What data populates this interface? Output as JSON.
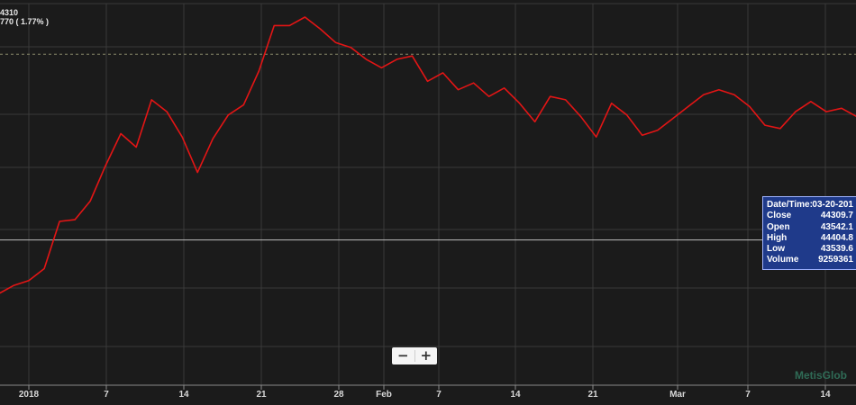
{
  "header": {
    "last_value": "4310",
    "change_text": "770 ( 1.77% )"
  },
  "tooltip": {
    "rows": [
      {
        "label": "Date/Time:",
        "value": "03-20-201"
      },
      {
        "label": "Close",
        "value": "44309.7"
      },
      {
        "label": "Open",
        "value": "43542.1"
      },
      {
        "label": "High",
        "value": "44404.8"
      },
      {
        "label": "Low",
        "value": "43539.6"
      },
      {
        "label": "Volume",
        "value": "9259361"
      }
    ]
  },
  "zoom": {
    "minus_label": "−",
    "plus_label": "+"
  },
  "watermark": "MetisGlob",
  "colors": {
    "background": "#1b1b1b",
    "series": "#e31515",
    "grid": "#3a3a3a",
    "tooltip_bg": "#1f3a8a"
  },
  "chart_data": {
    "type": "line",
    "x_tick_labels": [
      "2018",
      "7",
      "14",
      "21",
      "28",
      "Feb",
      "7",
      "14",
      "21",
      "Mar",
      "7",
      "14"
    ],
    "series": [
      {
        "values": [
          37200,
          37450,
          37600,
          37950,
          39350,
          39400,
          39950,
          41000,
          41950,
          41550,
          42950,
          42600,
          41850,
          40800,
          41800,
          42500,
          42800,
          43800,
          45150,
          45150,
          45400,
          45050,
          44650,
          44500,
          44150,
          43900,
          44150,
          44250,
          43500,
          43750,
          43250,
          43450,
          43050,
          43300,
          42850,
          42300,
          43050,
          42950,
          42450,
          41850,
          42850,
          42500,
          41900,
          42050,
          42400,
          42750,
          43100,
          43250,
          43100,
          42750,
          42200,
          42100,
          42600,
          42900,
          42600,
          42700,
          42450
        ]
      }
    ],
    "ylim": [
      34500,
      45800
    ],
    "reference_lines": [
      44300,
      38800
    ],
    "grid": true,
    "legend": "none"
  }
}
